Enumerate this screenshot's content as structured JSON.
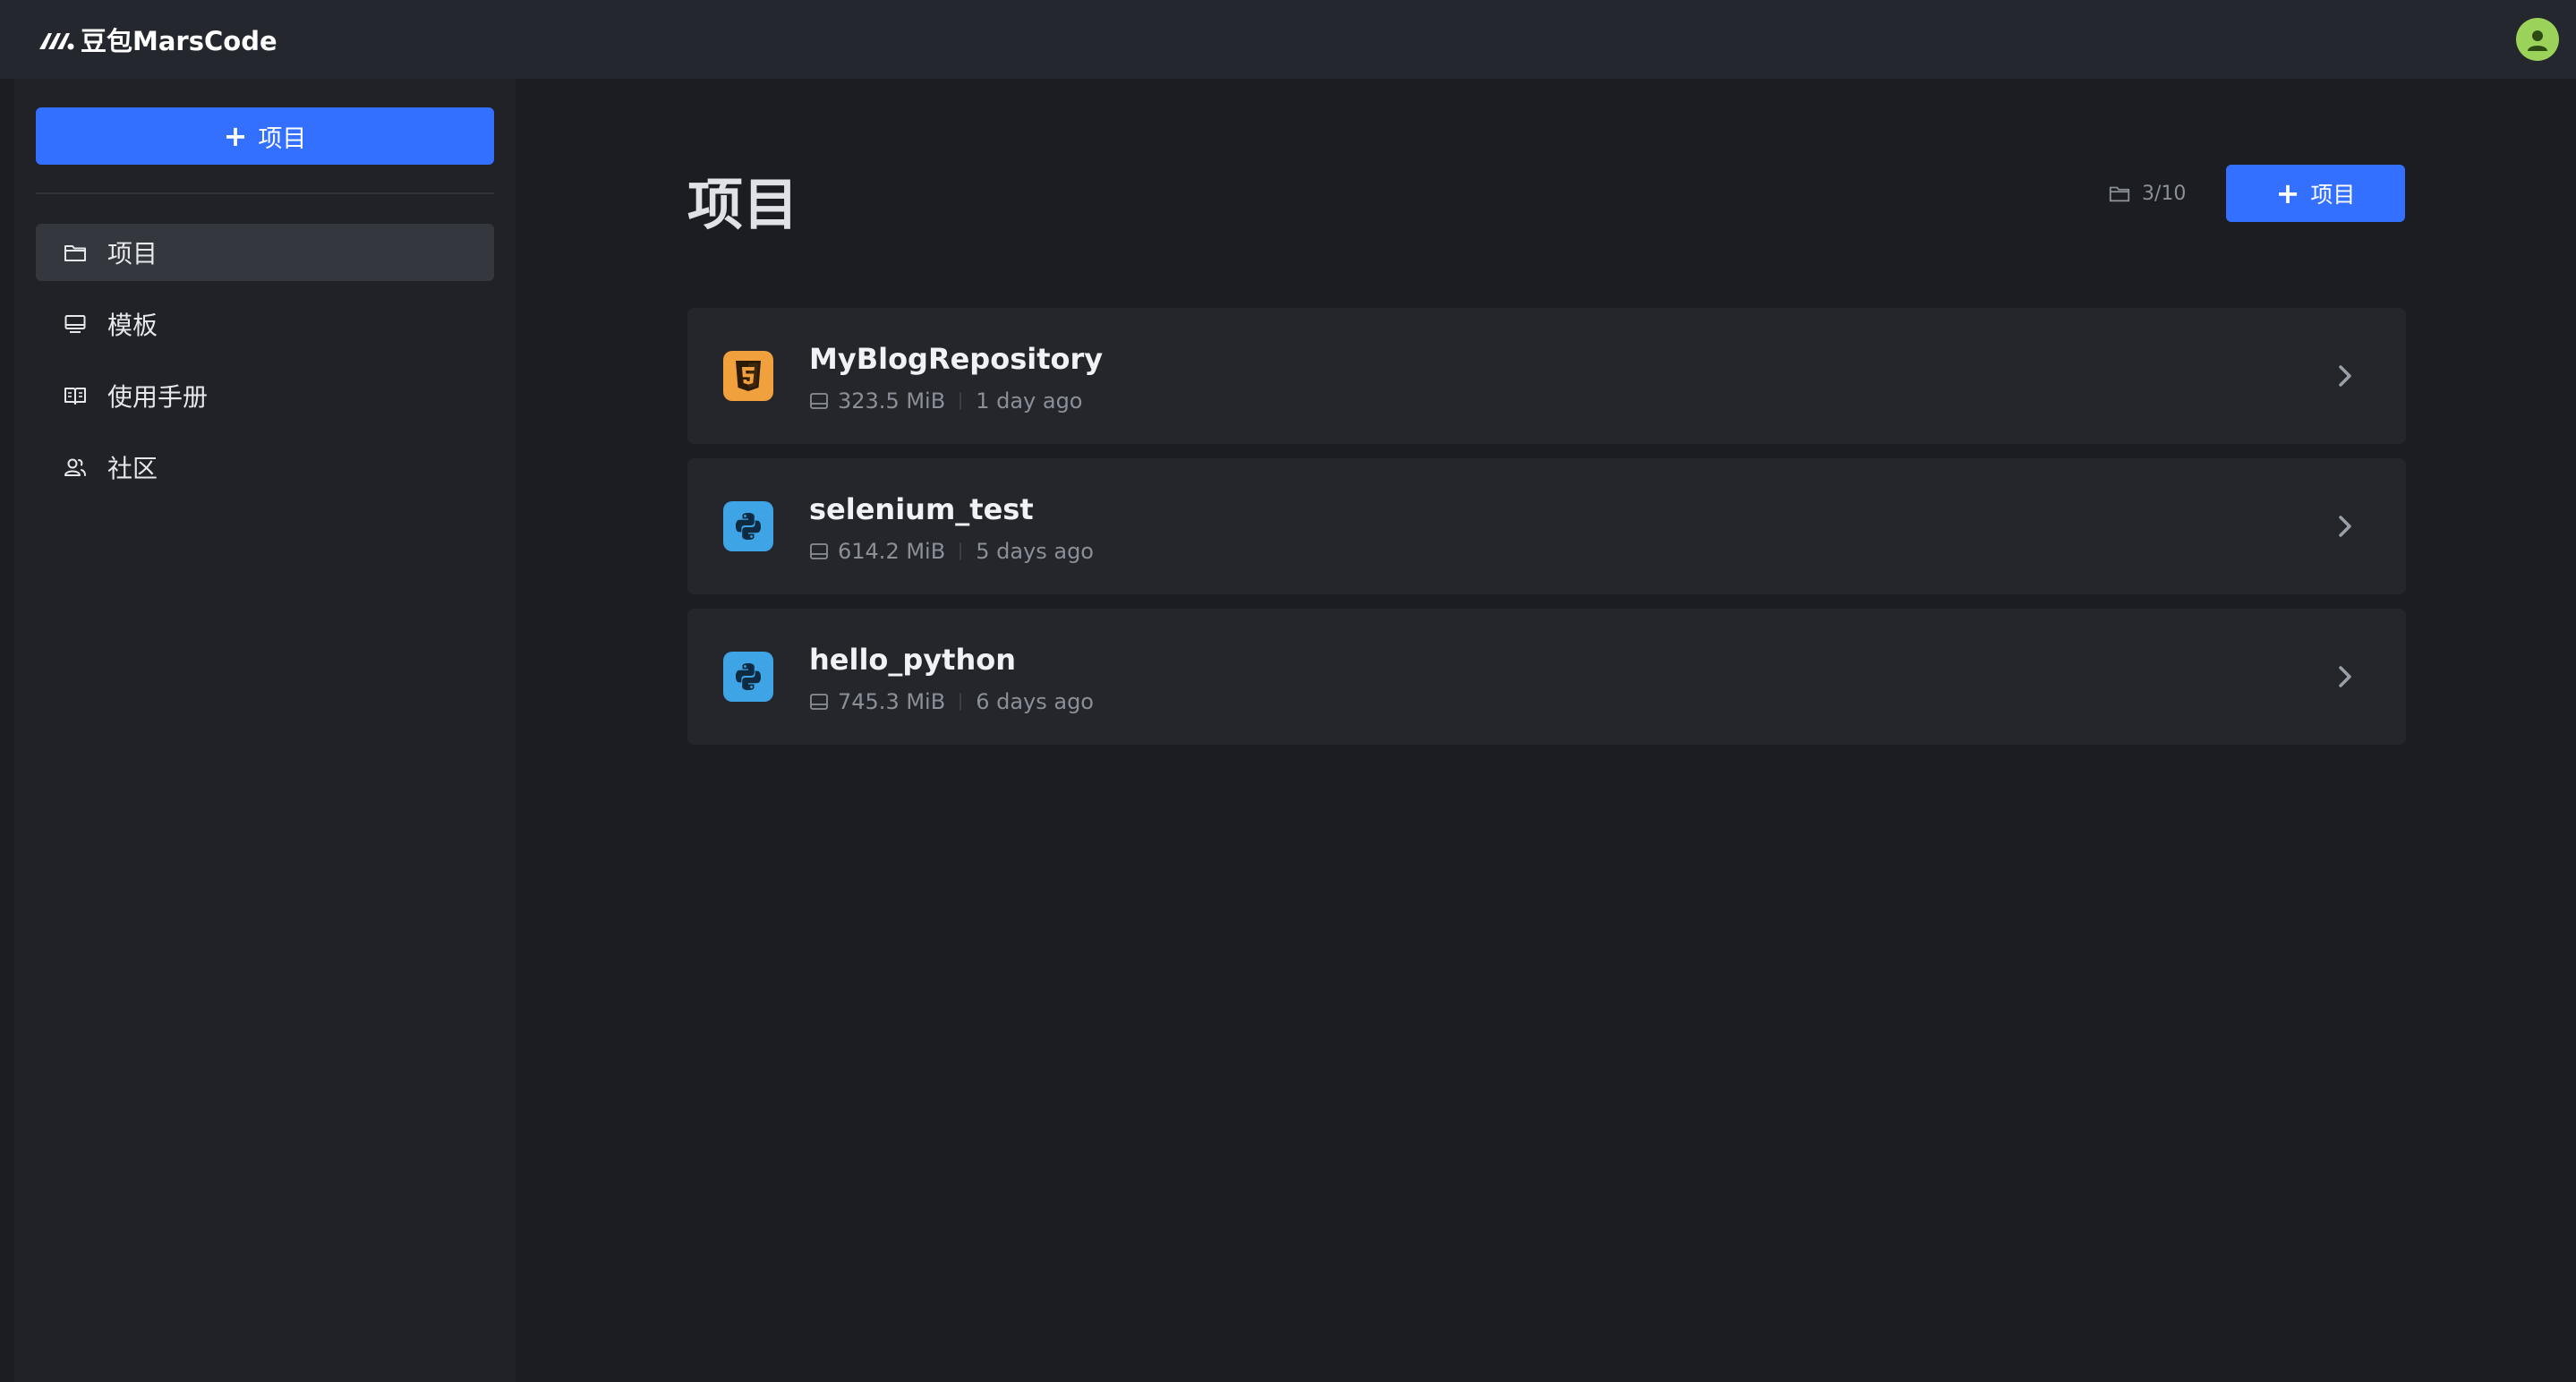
{
  "app": {
    "brand": "豆包MarsCode"
  },
  "sidebar": {
    "new_project_label": "项目",
    "items": [
      {
        "label": "项目",
        "icon": "folder-icon",
        "active": true
      },
      {
        "label": "模板",
        "icon": "monitor-icon",
        "active": false
      },
      {
        "label": "使用手册",
        "icon": "book-icon",
        "active": false
      },
      {
        "label": "社区",
        "icon": "users-icon",
        "active": false
      }
    ]
  },
  "main": {
    "title": "项目",
    "quota": "3/10",
    "new_project_label": "项目",
    "projects": [
      {
        "name": "MyBlogRepository",
        "size": "323.5 MiB",
        "updated": "1 day ago",
        "icon": "html5-icon"
      },
      {
        "name": "selenium_test",
        "size": "614.2 MiB",
        "updated": "5 days ago",
        "icon": "python-icon"
      },
      {
        "name": "hello_python",
        "size": "745.3 MiB",
        "updated": "6 days ago",
        "icon": "python-icon"
      }
    ]
  },
  "colors": {
    "accent": "#3370ff",
    "background": "#1b1d22",
    "card": "#24262c",
    "html5": "#f0a03c",
    "python": "#3fa4e6",
    "avatar": "#9bd35a"
  }
}
